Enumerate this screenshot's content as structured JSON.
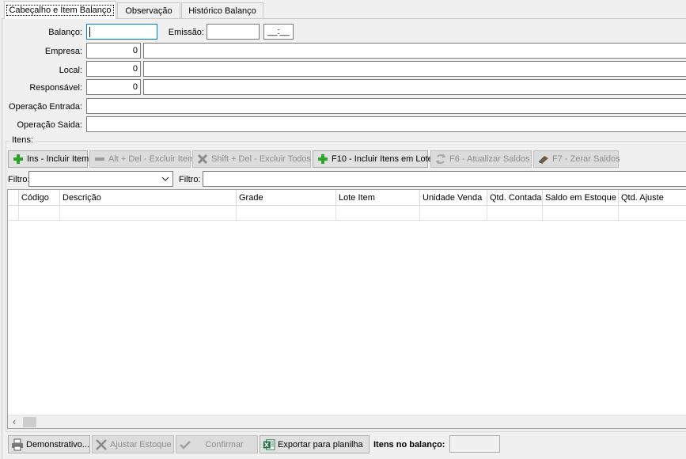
{
  "tabs": [
    {
      "label": "Cabeçalho e Item Balanço"
    },
    {
      "label": "Observação"
    },
    {
      "label": "Histórico Balanço"
    }
  ],
  "header": {
    "balanco_label": "Balanço:",
    "balanco_value": "",
    "emissao_label": "Emissão:",
    "emissao_value": "",
    "hora_value": "__:__",
    "empresa_label": "Empresa:",
    "empresa_code": "0",
    "empresa_name": "",
    "local_label": "Local:",
    "local_code": "0",
    "local_name": "",
    "responsavel_label": "Responsável:",
    "responsavel_code": "0",
    "responsavel_name": "",
    "operacao_entrada_label": "Operação Entrada:",
    "operacao_entrada_value": "",
    "operacao_saida_label": "Operação Saida:",
    "operacao_saida_value": ""
  },
  "itens": {
    "group_title": "Itens:",
    "toolbar": {
      "incluir": "Ins - Incluir Item",
      "excluir": "Alt + Del - Excluir Item",
      "excluir_todos": "Shift + Del - Excluir Todos",
      "incluir_lote": "F10 - Incluir Itens em Lote",
      "atualizar_saldos": "F6 - Atualizar Saldos",
      "zerar_saldos": "F7 - Zerar Saldos"
    },
    "filter1_label": "Filtro:",
    "filter1_value": "",
    "filter2_label": "Filtro:",
    "filter2_value": "",
    "columns": [
      "Código",
      "Descrição",
      "Grade",
      "Lote Item",
      "Unidade Venda",
      "Qtd. Contada",
      "Saldo em Estoque",
      "Qtd. Ajuste"
    ],
    "scroll_left": "‹"
  },
  "footer": {
    "demonstrativo": "Demonstrativo...",
    "ajustar_estoque": "Ajustar Estoque",
    "confirmar": "Confirmar",
    "exportar": "Exportar para planilha",
    "itens_no_balanco_label": "Itens no balanço:",
    "itens_no_balanco_value": ""
  },
  "colors": {
    "focus_border": "#0078d7",
    "plus_green": "#2aa52a",
    "excel_green": "#1d6f42"
  }
}
